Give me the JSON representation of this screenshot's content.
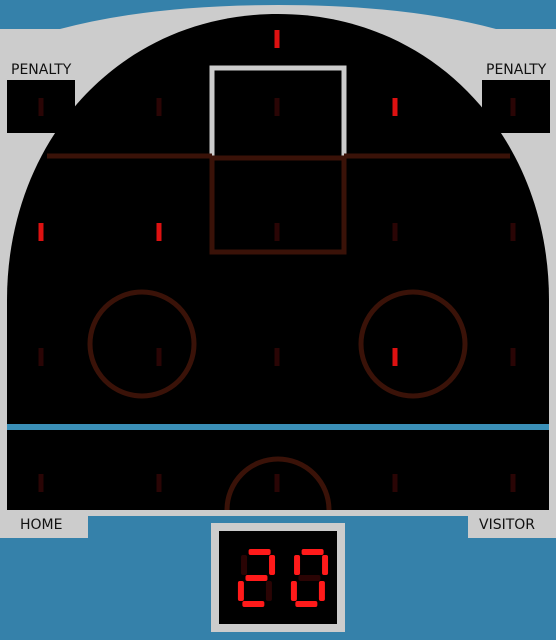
{
  "labels": {
    "penalty_left": "PENALTY",
    "penalty_right": "PENALTY",
    "home": "HOME",
    "visitor": "VISITOR"
  },
  "clock": {
    "digits": "20"
  },
  "colors": {
    "background": "#3581aa",
    "frame": "#cccccc",
    "board": "#000000",
    "rink_lines": "#3a1208",
    "blue_line": "#3a8fb7",
    "lamp_on": "#dd1111",
    "lamp_off": "#2a0505",
    "digit_on": "#ff1a1a",
    "digit_off": "#2a0404"
  },
  "lamps": {
    "rows": [
      [
        false,
        false,
        false,
        true,
        false
      ],
      [
        true,
        true,
        false,
        false,
        false
      ],
      [
        false,
        false,
        false,
        true,
        false
      ],
      [
        false,
        false,
        false,
        false,
        false
      ]
    ],
    "top_center": true
  }
}
